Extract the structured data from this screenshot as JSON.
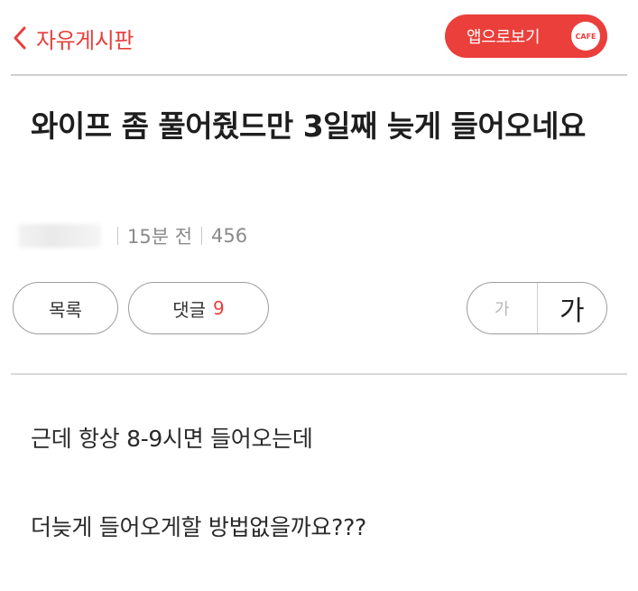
{
  "header": {
    "back_label": "자유게시판",
    "app_button_label": "앱으로보기",
    "cafe_badge": "CAFE"
  },
  "post": {
    "title": "와이프 좀 풀어줬드만 3일째 늦게 들어오네요",
    "time": "15분 전",
    "views": "456",
    "body": [
      "근데 항상 8-9시면 들어오는데",
      "더늦게 들어오게할 방법없을까요???"
    ]
  },
  "actions": {
    "list_label": "목록",
    "comment_label": "댓글",
    "comment_count": "9",
    "font_small": "가",
    "font_large": "가"
  },
  "colors": {
    "accent": "#ea3f3b",
    "divider": "#cfcfcf",
    "meta": "#8a8a8a"
  },
  "icons": {
    "back": "chevron-left-icon",
    "cafe": "cafe-badge-icon"
  }
}
